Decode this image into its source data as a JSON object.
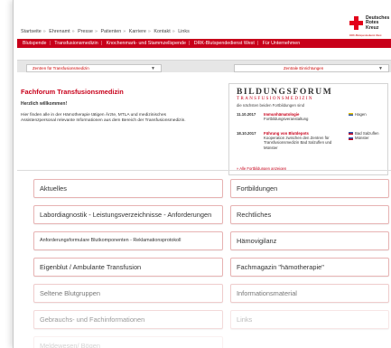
{
  "topnav": [
    "Startseite",
    "Ehrenamt",
    "Presse",
    "Patienten",
    "Karriere",
    "Kontakt",
    "Links"
  ],
  "logo": {
    "line1": "Deutsches",
    "line2": "Rotes",
    "line3": "Kreuz",
    "sub": "DRK-Blutspendedienst West"
  },
  "redbar": [
    "Blutspende",
    "Transfusionsmedizin",
    "Knochenmark- und Stammzellspende",
    "DRK-Blutspendedienst West",
    "Für Unternehmen"
  ],
  "selects": {
    "left": "Zentren für Transfusionsmedizin",
    "right": "Zentrale Einrichtungen"
  },
  "main": {
    "title": "Fachforum Transfusionsmedizin",
    "welcome": "Herzlich willkommen!",
    "intro": "Hier finden alle in der Hämotherapie tätigen Ärzte, MTLA und medizinisches Assistenzpersonal relevante Informationen aus dem Bereich der Transfusionsmedizin."
  },
  "bildungsforum": {
    "title": "BILDUNGSFORUM",
    "subtitle": "TRANSFUSIONSMEDIZIN",
    "tagline": "die nächsten beiden Fortbildungen sind",
    "events": [
      {
        "date": "11.10.2017",
        "name": "Immunhämatologie",
        "desc": "Fortbildungsveranstaltung",
        "loc1": "Hagen",
        "loc2": ""
      },
      {
        "date": "18.10.2017",
        "name": "Führung von Blutdepots",
        "desc": "Kooperation zwischen den Zentren für Transfusionsmedizin Bad Salzuflen und Münster",
        "loc1": "Bad Salzuflen",
        "loc2": "Münster"
      }
    ],
    "more": "» Alle Fortbildungen anzeigen"
  },
  "tiles_left": [
    "Aktuelles",
    "Labordiagnostik - Leistungsverzeichnisse - Anforderungen",
    "Anforderungsformulare Blutkomponenten - Reklamationsprotokoll",
    "Eigenblut / Ambulante Transfusion",
    "Seltene Blutgruppen",
    "Gebrauchs- und Fachinformationen",
    "Meldewesen/ Bögen"
  ],
  "tiles_right": [
    "Fortbildungen",
    "Rechtliches",
    "Hämovigilanz",
    "Fachmagazin \"hämotherapie\"",
    "Informationsmaterial",
    "Links"
  ],
  "colors": {
    "brand_red": "#c8001a"
  }
}
